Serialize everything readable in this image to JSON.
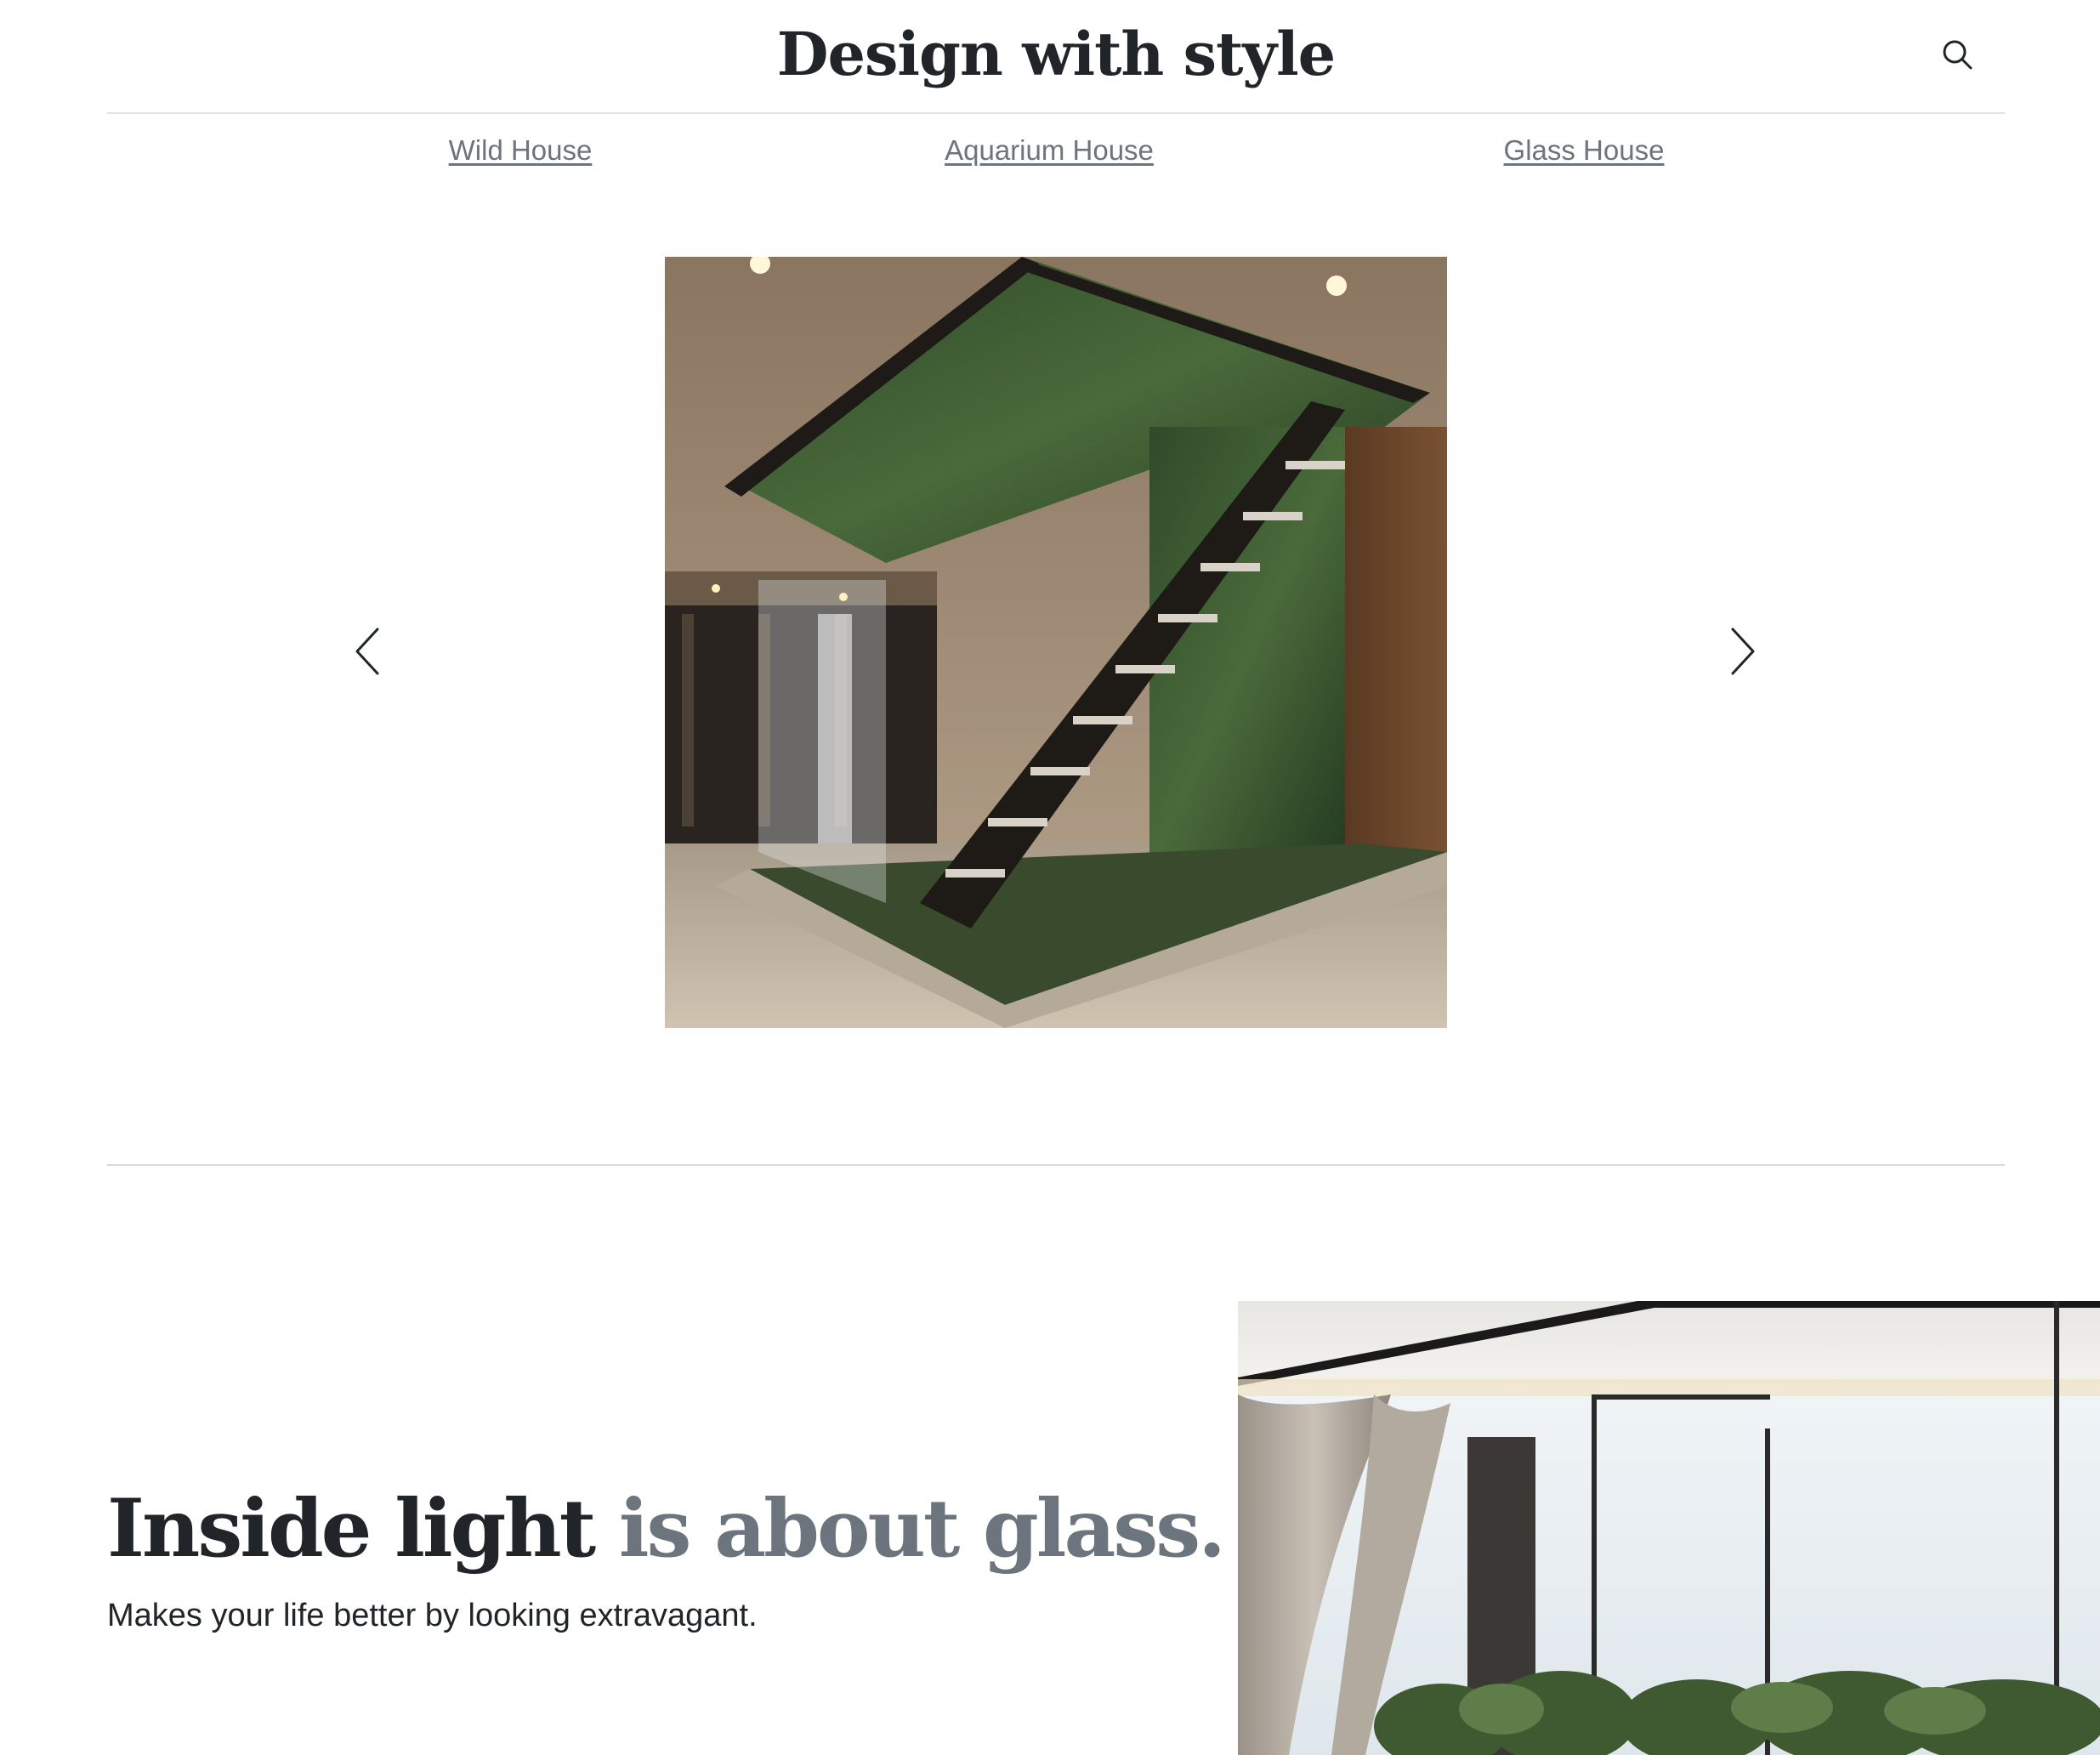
{
  "header": {
    "title": "Design with style",
    "search_icon": "search-icon"
  },
  "nav": {
    "links": [
      {
        "label": "Wild House"
      },
      {
        "label": "Aquarium House"
      },
      {
        "label": "Glass House"
      }
    ]
  },
  "carousel": {
    "image": "indoor-garden-staircase-photo",
    "prev_icon": "chevron-left-icon",
    "next_icon": "chevron-right-icon"
  },
  "feature": {
    "heading_strong": "Inside light",
    "heading_muted": "is about glass.",
    "subtext": "Makes your life better by looking extravagant.",
    "image": "glass-room-curtains-photo"
  },
  "colors": {
    "text_dark": "#212529",
    "text_muted": "#6c757d",
    "divider": "#d6d8db"
  }
}
